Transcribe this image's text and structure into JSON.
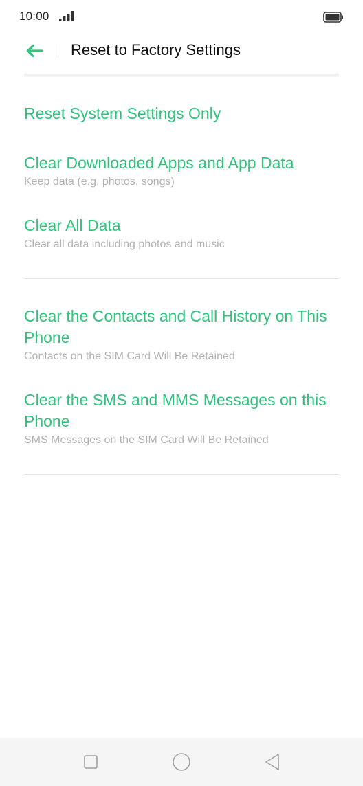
{
  "status_bar": {
    "time": "10:00"
  },
  "header": {
    "title": "Reset to Factory Settings",
    "back_icon": "arrow-left-icon",
    "accent_color": "#2fc37c"
  },
  "options": [
    {
      "title": "Reset System Settings Only",
      "subtitle": ""
    },
    {
      "title": "Clear Downloaded Apps and App Data",
      "subtitle": "Keep data (e.g. photos, songs)"
    },
    {
      "title": "Clear All Data",
      "subtitle": "Clear all data including photos and music"
    },
    {
      "title": "Clear the Contacts and Call History on This Phone",
      "subtitle": "Contacts on the SIM Card Will Be Retained"
    },
    {
      "title": "Clear the SMS and MMS Messages on this Phone",
      "subtitle": "SMS Messages on the SIM Card Will Be Retained"
    }
  ],
  "nav_bar": {
    "icons": [
      "square-recents-icon",
      "circle-home-icon",
      "triangle-back-icon"
    ]
  }
}
